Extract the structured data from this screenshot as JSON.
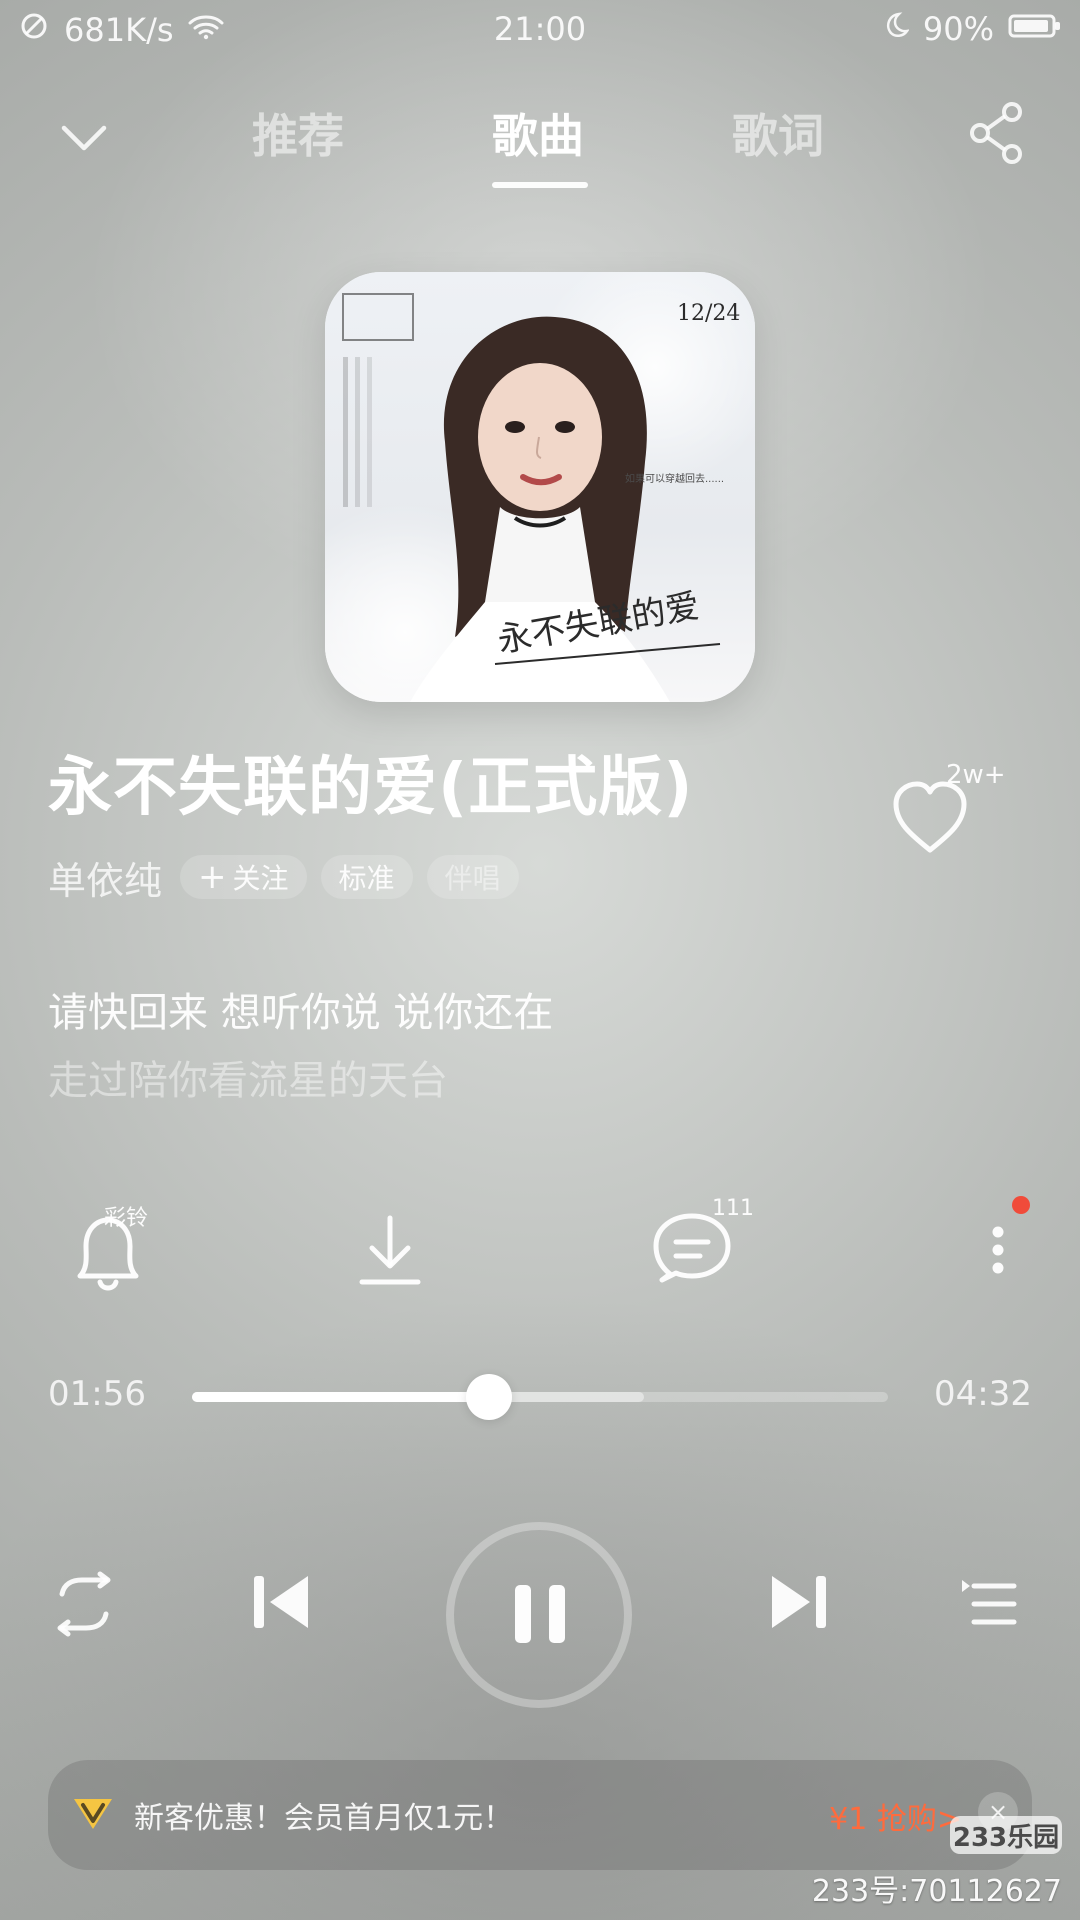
{
  "status_bar": {
    "network_speed": "681K/s",
    "time": "21:00",
    "battery": "90%"
  },
  "top_nav": {
    "tabs": [
      "推荐",
      "歌曲",
      "歌词"
    ],
    "active_tab": "歌曲"
  },
  "song": {
    "title": "永不失联的爱(正式版)",
    "artist": "单依纯",
    "follow_label": "关注",
    "quality_label": "标准",
    "accompaniment_label": "伴唱",
    "like_count": "2w+"
  },
  "lyrics": {
    "current": "请快回来 想听你说 说你还在",
    "next": "走过陪你看流星的天台"
  },
  "actions": {
    "ringtone_label": "彩铃",
    "comment_count": "111"
  },
  "playback": {
    "elapsed": "01:56",
    "duration": "04:32",
    "progress_fraction": 0.4265,
    "buffered_fraction": 0.65
  },
  "promo": {
    "text": "新客优惠！会员首月仅1元！",
    "cta": "¥1 抢购>",
    "close_label": "×"
  },
  "album_cover": {
    "date_label": "12/24",
    "caption": "如果可以穿越回去......",
    "handwritten_title": "永不失联的爱"
  },
  "watermark": {
    "logo_text": "233乐园",
    "id_text": "233号:70112627"
  },
  "colors": {
    "accent_orange": "#ff6b3d",
    "notification_red": "#f04b3a",
    "white": "#ffffff"
  },
  "icons": {
    "back": "chevron-down-icon",
    "share": "share-icon",
    "like": "heart-icon",
    "ringtone": "bell-icon",
    "download": "download-icon",
    "comments": "comment-icon",
    "more": "more-vertical-icon",
    "repeat": "repeat-icon",
    "previous": "skip-previous-icon",
    "pause": "pause-icon",
    "next": "skip-next-icon",
    "playlist": "playlist-icon",
    "vip": "vip-icon"
  }
}
